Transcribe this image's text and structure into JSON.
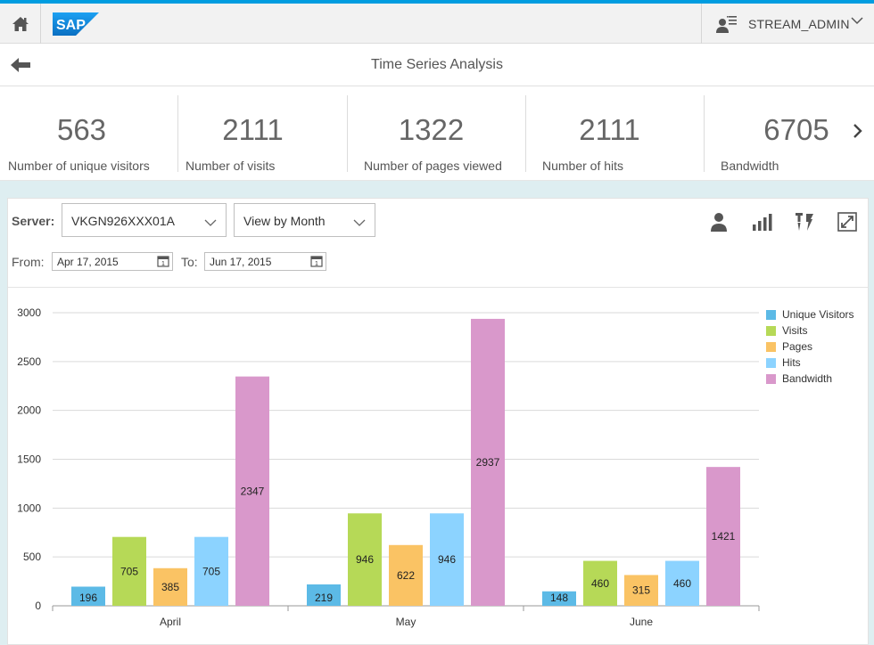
{
  "header": {
    "brand": "SAP",
    "user_name": "STREAM_ADMIN",
    "icons": {
      "home": "home-icon",
      "user": "user-menu-icon",
      "chevron": "chevron-down-icon"
    }
  },
  "nav": {
    "title": "Time Series Analysis",
    "back_icon": "back-arrow-icon"
  },
  "kpis": [
    {
      "value": "563",
      "label": "Number of unique visitors"
    },
    {
      "value": "2111",
      "label": "Number of visits"
    },
    {
      "value": "1322",
      "label": "Number of pages viewed"
    },
    {
      "value": "2111",
      "label": "Number of hits"
    },
    {
      "value": "6705",
      "label": "Bandwidth"
    }
  ],
  "filters": {
    "server_label": "Server:",
    "server_value": "VKGN926XXX01A",
    "view_value": "View by Month",
    "from_label": "From:",
    "from_value": "Apr 17, 2015",
    "to_label": "To:",
    "to_value": "Jun 17, 2015"
  },
  "toolbar_icons": [
    "person-icon",
    "bar-chart-icon",
    "settings-icon",
    "fullscreen-icon"
  ],
  "colors": {
    "accent": "#009de0",
    "unique_visitors": "#5cbae6",
    "visits": "#b6d957",
    "pages": "#fac364",
    "hits": "#8cd3ff",
    "bandwidth": "#d998cb"
  },
  "chart_data": {
    "type": "bar",
    "categories": [
      "April",
      "May",
      "June"
    ],
    "series": [
      {
        "name": "Unique Visitors",
        "color": "#5cbae6",
        "values": [
          196,
          219,
          148
        ]
      },
      {
        "name": "Visits",
        "color": "#b6d957",
        "values": [
          705,
          946,
          460
        ]
      },
      {
        "name": "Pages",
        "color": "#fac364",
        "values": [
          385,
          622,
          315
        ]
      },
      {
        "name": "Hits",
        "color": "#8cd3ff",
        "values": [
          705,
          946,
          460
        ]
      },
      {
        "name": "Bandwidth",
        "color": "#d998cb",
        "values": [
          2347,
          2937,
          1421
        ]
      }
    ],
    "ylim": [
      0,
      3000
    ],
    "yticks": [
      "0",
      "500",
      "1000",
      "1500",
      "2000",
      "2500",
      "3000"
    ],
    "xlabel": "",
    "ylabel": "",
    "grid": true,
    "legend": "right"
  }
}
